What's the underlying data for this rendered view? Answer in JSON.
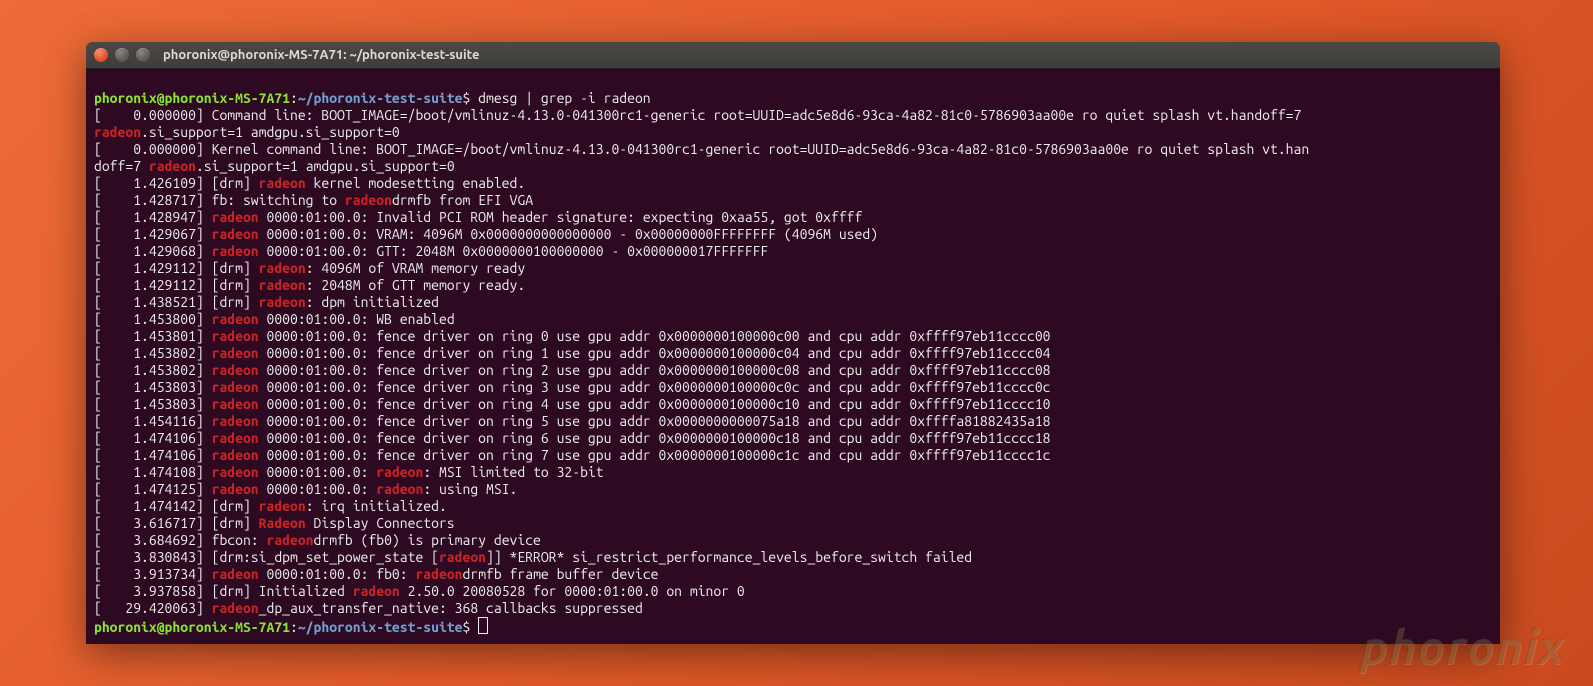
{
  "window": {
    "title": "phoronix@phoronix-MS-7A71: ~/phoronix-test-suite"
  },
  "prompt": {
    "user_host": "phoronix@phoronix-MS-7A71",
    "colon": ":",
    "path": "~/phoronix-test-suite",
    "dollar": "$"
  },
  "command": "dmesg | grep -i radeon",
  "hl": {
    "radeon": "radeon",
    "Radeon": "Radeon"
  },
  "lines": {
    "l01a": "[    0.000000] Command line: BOOT_IMAGE=/boot/vmlinuz-4.13.0-041300rc1-generic root=UUID=adc5e8d6-93ca-4a82-81c0-5786903aa00e ro quiet splash vt.handoff=7 ",
    "l01b": ".si_support=1 amdgpu.si_support=0",
    "l02a": "[    0.000000] Kernel command line: BOOT_IMAGE=/boot/vmlinuz-4.13.0-041300rc1-generic root=UUID=adc5e8d6-93ca-4a82-81c0-5786903aa00e ro quiet splash vt.han",
    "l02b": "doff=7 ",
    "l02c": ".si_support=1 amdgpu.si_support=0",
    "l03a": "[    1.426109] [drm] ",
    "l03b": " kernel modesetting enabled.",
    "l04a": "[    1.428717] fb: switching to ",
    "l04b": "drmfb from EFI VGA",
    "l05a": "[    1.428947] ",
    "l05b": " 0000:01:00.0: Invalid PCI ROM header signature: expecting 0xaa55, got 0xffff",
    "l06a": "[    1.429067] ",
    "l06b": " 0000:01:00.0: VRAM: 4096M 0x0000000000000000 - 0x00000000FFFFFFFF (4096M used)",
    "l07a": "[    1.429068] ",
    "l07b": " 0000:01:00.0: GTT: 2048M 0x0000000100000000 - 0x000000017FFFFFFF",
    "l08a": "[    1.429112] [drm] ",
    "l08b": ": 4096M of VRAM memory ready",
    "l09a": "[    1.429112] [drm] ",
    "l09b": ": 2048M of GTT memory ready.",
    "l10a": "[    1.438521] [drm] ",
    "l10b": ": dpm initialized",
    "l11a": "[    1.453800] ",
    "l11b": " 0000:01:00.0: WB enabled",
    "l12a": "[    1.453801] ",
    "l12b": " 0000:01:00.0: fence driver on ring 0 use gpu addr 0x0000000100000c00 and cpu addr 0xffff97eb11cccc00",
    "l13a": "[    1.453802] ",
    "l13b": " 0000:01:00.0: fence driver on ring 1 use gpu addr 0x0000000100000c04 and cpu addr 0xffff97eb11cccc04",
    "l14a": "[    1.453802] ",
    "l14b": " 0000:01:00.0: fence driver on ring 2 use gpu addr 0x0000000100000c08 and cpu addr 0xffff97eb11cccc08",
    "l15a": "[    1.453803] ",
    "l15b": " 0000:01:00.0: fence driver on ring 3 use gpu addr 0x0000000100000c0c and cpu addr 0xffff97eb11cccc0c",
    "l16a": "[    1.453803] ",
    "l16b": " 0000:01:00.0: fence driver on ring 4 use gpu addr 0x0000000100000c10 and cpu addr 0xffff97eb11cccc10",
    "l17a": "[    1.454116] ",
    "l17b": " 0000:01:00.0: fence driver on ring 5 use gpu addr 0x0000000000075a18 and cpu addr 0xffffa81882435a18",
    "l18a": "[    1.474106] ",
    "l18b": " 0000:01:00.0: fence driver on ring 6 use gpu addr 0x0000000100000c18 and cpu addr 0xffff97eb11cccc18",
    "l19a": "[    1.474106] ",
    "l19b": " 0000:01:00.0: fence driver on ring 7 use gpu addr 0x0000000100000c1c and cpu addr 0xffff97eb11cccc1c",
    "l20a": "[    1.474108] ",
    "l20b": " 0000:01:00.0: ",
    "l20c": ": MSI limited to 32-bit",
    "l21a": "[    1.474125] ",
    "l21b": " 0000:01:00.0: ",
    "l21c": ": using MSI.",
    "l22a": "[    1.474142] [drm] ",
    "l22b": ": irq initialized.",
    "l23a": "[    3.616717] [drm] ",
    "l23b": " Display Connectors",
    "l24a": "[    3.684692] fbcon: ",
    "l24b": "drmfb (fb0) is primary device",
    "l25a": "[    3.830843] [drm:si_dpm_set_power_state [",
    "l25b": "]] *ERROR* si_restrict_performance_levels_before_switch failed",
    "l26a": "[    3.913734] ",
    "l26b": " 0000:01:00.0: fb0: ",
    "l26c": "drmfb frame buffer device",
    "l27a": "[    3.937858] [drm] Initialized ",
    "l27b": " 2.50.0 20080528 for 0000:01:00.0 on minor 0",
    "l28a": "[   29.420063] ",
    "l28b": "_dp_aux_transfer_native: 368 callbacks suppressed"
  },
  "watermark": "phoronix"
}
